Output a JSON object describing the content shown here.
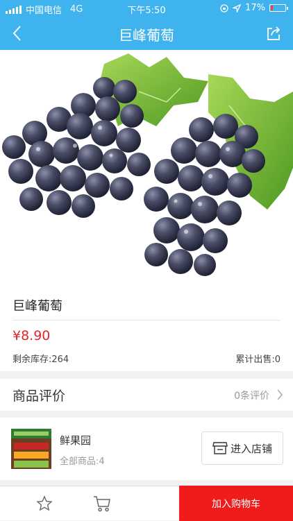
{
  "status_bar": {
    "carrier": "中国电信",
    "network": "4G",
    "time": "下午5:50",
    "battery_percent": "17%",
    "battery_level": 0.17
  },
  "nav": {
    "title": "巨峰葡萄",
    "back_icon": "chevron-left-icon",
    "share_icon": "share-icon"
  },
  "product": {
    "name": "巨峰葡萄",
    "price": "¥8.90",
    "stock": "剩余库存:264",
    "sold": "累计出售:0"
  },
  "reviews": {
    "title": "商品评价",
    "count": "0条评价"
  },
  "shop": {
    "name": "鲜果园",
    "all_products": "全部商品:4",
    "enter_label": "进入店铺"
  },
  "bottom": {
    "add_to_cart": "加入购物车",
    "fav_icon": "star-icon",
    "cart_icon": "cart-icon"
  },
  "colors": {
    "primary": "#3fb3ee",
    "price": "#e5232b",
    "cta": "#f01b1b"
  }
}
